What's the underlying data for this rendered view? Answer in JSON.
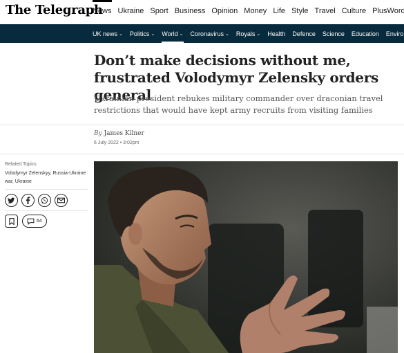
{
  "header": {
    "logo": "The Telegraph",
    "nav": [
      "News",
      "Ukraine",
      "Sport",
      "Business",
      "Opinion",
      "Money",
      "Life",
      "Style",
      "Travel",
      "Culture",
      "PlusWord"
    ]
  },
  "sections": [
    {
      "label": "UK news",
      "has_menu": true
    },
    {
      "label": "Politics",
      "has_menu": true
    },
    {
      "label": "World",
      "has_menu": true
    },
    {
      "label": "Coronavirus",
      "has_menu": true
    },
    {
      "label": "Royals",
      "has_menu": true
    },
    {
      "label": "Health",
      "has_menu": false
    },
    {
      "label": "Defence",
      "has_menu": false
    },
    {
      "label": "Science",
      "has_menu": false
    },
    {
      "label": "Education",
      "has_menu": false
    },
    {
      "label": "Environment",
      "has_menu": false
    }
  ],
  "article": {
    "headline": "Don’t make decisions without me, frustrated Volodymyr Zelensky orders general",
    "standfirst": "Ukrainian president rebukes military commander over draconian travel restrictions that would have kept army recruits from visiting families",
    "by_prefix": "By",
    "author": "James Kilner",
    "date": "6 July 2022 • 3:02pm"
  },
  "sidebar": {
    "related_label": "Related Topics",
    "related_topics": "Volodymyr Zelenskyy, Russia-Ukraine war, Ukraine",
    "comment_count": "64",
    "share_icons": [
      "twitter-icon",
      "facebook-icon",
      "whatsapp-icon",
      "email-icon"
    ]
  },
  "colors": {
    "section_bar": "#072a3c",
    "headline": "#222222"
  }
}
